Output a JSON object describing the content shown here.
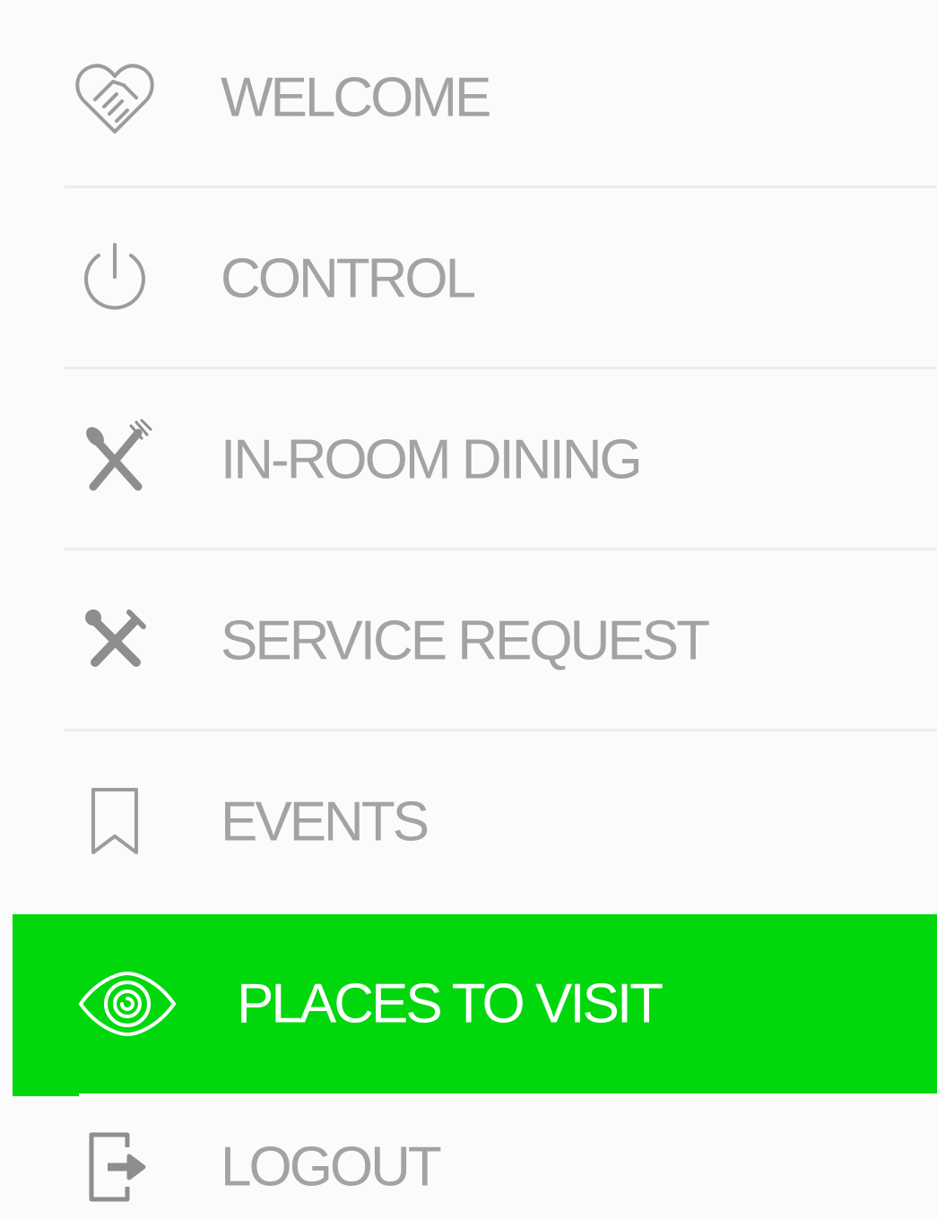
{
  "colors": {
    "accent": "#00d80d",
    "text": "#a3a3a3",
    "active_text": "#ffffff",
    "divider": "#ececec"
  },
  "menu": {
    "items": [
      {
        "label": "WELCOME",
        "icon": "handshake-heart-icon"
      },
      {
        "label": "CONTROL",
        "icon": "power-icon"
      },
      {
        "label": "IN-ROOM DINING",
        "icon": "fork-spoon-icon"
      },
      {
        "label": "SERVICE REQUEST",
        "icon": "tools-icon"
      },
      {
        "label": "EVENTS",
        "icon": "bookmark-icon"
      },
      {
        "label": "PLACES TO VISIT",
        "icon": "eye-icon",
        "active": true
      },
      {
        "label": "LOGOUT",
        "icon": "logout-icon"
      }
    ]
  }
}
